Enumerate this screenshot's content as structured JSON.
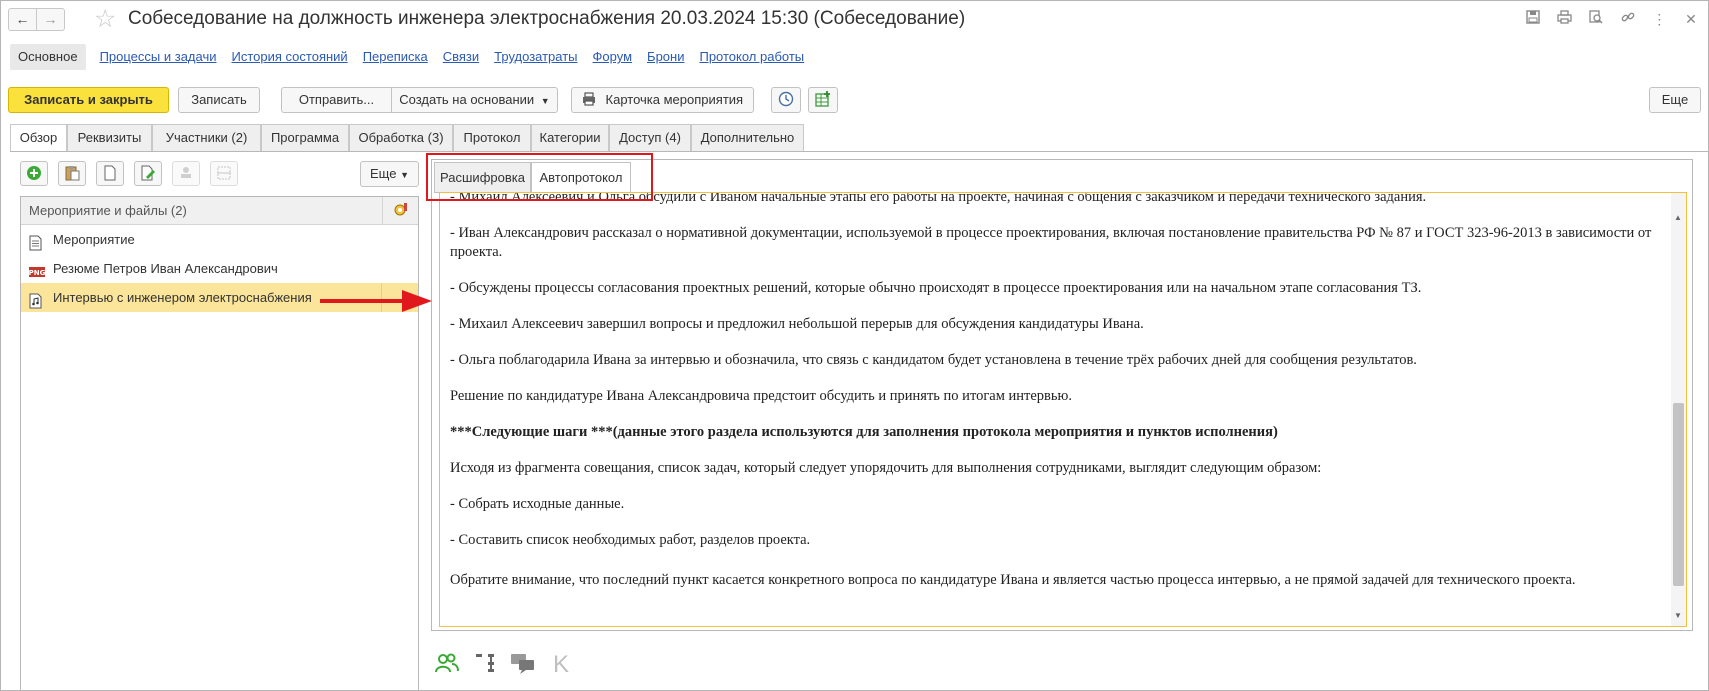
{
  "window": {
    "title": "Собеседование на должность инженера электроснабжения 20.03.2024 15:30 (Собеседование)",
    "icons": [
      "save-icon",
      "print-icon",
      "search-doc-icon",
      "link-icon",
      "more-vertical-icon",
      "close-icon"
    ]
  },
  "section_nav": [
    {
      "label": "Основное",
      "active": true
    },
    {
      "label": "Процессы и задачи"
    },
    {
      "label": "История состояний"
    },
    {
      "label": "Переписка"
    },
    {
      "label": "Связи"
    },
    {
      "label": "Трудозатраты"
    },
    {
      "label": "Форум"
    },
    {
      "label": "Брони"
    },
    {
      "label": "Протокол работы"
    }
  ],
  "commands": {
    "save_close": "Записать и закрыть",
    "save": "Записать",
    "send": "Отправить...",
    "create_based": "Создать на основании",
    "event_card": "Карточка мероприятия",
    "more": "Еще"
  },
  "main_tabs": [
    {
      "label": "Обзор",
      "active": true
    },
    {
      "label": "Реквизиты"
    },
    {
      "label": "Участники (2)"
    },
    {
      "label": "Программа"
    },
    {
      "label": "Обработка (3)"
    },
    {
      "label": "Протокол"
    },
    {
      "label": "Категории"
    },
    {
      "label": "Доступ (4)"
    },
    {
      "label": "Дополнительно"
    }
  ],
  "left_panel": {
    "more": "Еще",
    "list_header": "Мероприятие и файлы (2)",
    "items": [
      {
        "label": "Мероприятие",
        "icon": "document-icon"
      },
      {
        "label": "Резюме Петров Иван Александрович",
        "icon": "png-file-icon"
      },
      {
        "label": "Интервью с инженером электроснабжения",
        "icon": "audio-file-icon",
        "selected": true
      }
    ]
  },
  "right_panel": {
    "subtabs": [
      {
        "label": "Расшифровка"
      },
      {
        "label": "Автопротокол",
        "active": true
      }
    ],
    "paragraphs": [
      {
        "text": "- Михаил Алексеевич и Ольга обсудили с Иваном начальные этапы его работы на проекте, начиная с общения с заказчиком и передачи технического задания."
      },
      {
        "text": "- Иван Александрович рассказал о нормативной документации, используемой в процессе проектирования, включая постановление правительства РФ № 87 и ГОСТ 323-96-2013 в зависимости от проекта."
      },
      {
        "text": "- Обсуждены процессы согласования проектных решений, которые обычно происходят в процессе проектирования или на начальном этапе согласования ТЗ."
      },
      {
        "text": "- Михаил Алексеевич завершил вопросы и предложил небольшой перерыв для обсуждения кандидатуры Ивана."
      },
      {
        "text": "- Ольга поблагодарила Ивана за интервью и обозначила, что связь с кандидатом будет установлена в течение трёх рабочих дней для сообщения результатов."
      },
      {
        "text": "Решение по кандидатуре Ивана Александровича предстоит обсудить и принять по итогам интервью."
      },
      {
        "text": "***Следующие шаги ***(данные этого раздела используются для заполнения протокола мероприятия и пунктов исполнения)",
        "bold": true
      },
      {
        "text": "Исходя из фрагмента совещания, список задач, который следует упорядочить для выполнения сотрудниками, выглядит следующим образом:"
      },
      {
        "text": "- Собрать исходные данные."
      },
      {
        "text": "- Составить список необходимых работ, разделов проекта."
      },
      {
        "text": "Обратите внимание, что последний пункт касается конкретного вопроса по кандидатуре Ивана и является частью процесса интервью, а не прямой задачей для технического проекта."
      }
    ]
  },
  "bottom_icons": [
    "users-icon",
    "hierarchy-icon",
    "chat-icon",
    "k-icon"
  ],
  "colors": {
    "primary_button": "#fbe13b",
    "selection": "#fae59a",
    "link": "#2a5ab3",
    "callout": "#e0181e"
  }
}
